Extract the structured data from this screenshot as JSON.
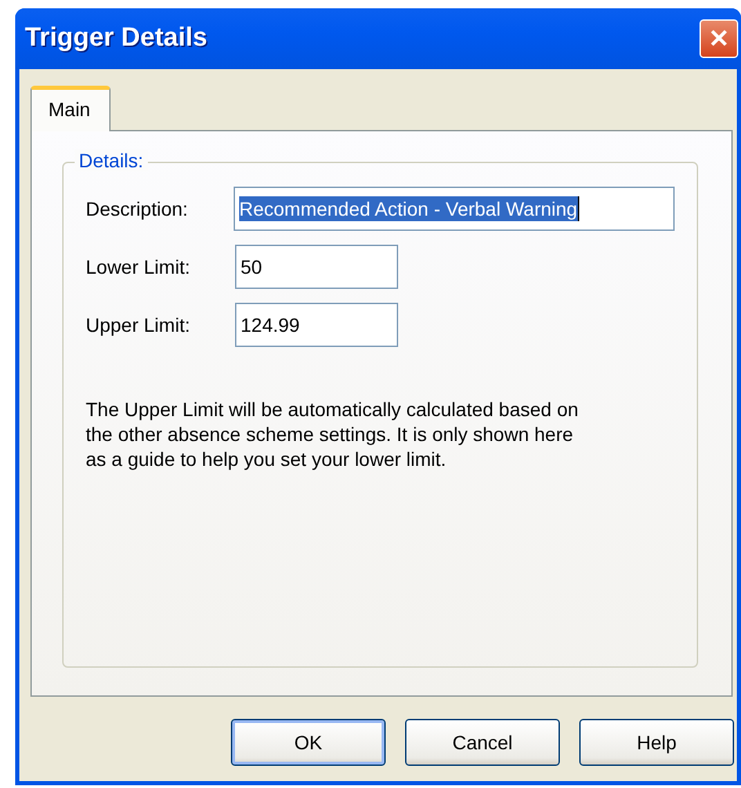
{
  "window": {
    "title": "Trigger Details",
    "close": "✕"
  },
  "tabs": [
    {
      "label": "Main",
      "selected": true
    }
  ],
  "group": {
    "title": "Details:"
  },
  "fields": [
    {
      "label": "Description:",
      "value": "Recommended Action - Verbal Warning",
      "text_selected": true,
      "wide": true
    },
    {
      "label": "Lower Limit:",
      "value": "50",
      "text_selected": false,
      "wide": false
    },
    {
      "label": "Upper Limit:",
      "value": "124.99",
      "text_selected": false,
      "wide": false
    }
  ],
  "note": "The Upper Limit will be automatically calculated based on the other absence scheme settings. It is only shown here as a guide to help you set your lower limit.",
  "buttons": [
    {
      "label": "OK",
      "default": true
    },
    {
      "label": "Cancel",
      "default": false
    },
    {
      "label": "Help",
      "default": false
    }
  ]
}
